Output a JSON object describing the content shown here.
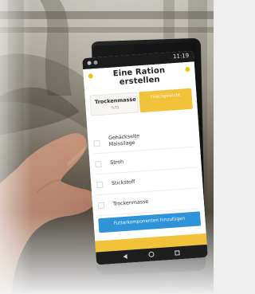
{
  "photo": {
    "alt": "Hand holding a smartphone showing a feed ration app inside a barn"
  },
  "status_bar": {
    "time": "11:19"
  },
  "app": {
    "title": "Eine Ration erstellen",
    "toggle_left_main": "Trockenmasse",
    "toggle_left_sub": "%TS",
    "toggle_right_label": "Frischgewicht",
    "table_header": [
      "",
      "",
      ""
    ],
    "rows": [
      {
        "name": "Gehäckselte Maissilage",
        "v1": "",
        "v2": ""
      },
      {
        "name": "Stroh",
        "v1": "",
        "v2": ""
      },
      {
        "name": "Stickstoff",
        "v1": "",
        "v2": ""
      },
      {
        "name": "Trockenmasse",
        "v1": "",
        "v2": ""
      }
    ],
    "cta": "Futterkomponenten hinzufügen",
    "bottom_label": ""
  },
  "colors": {
    "accent": "#f2c33a",
    "primary": "#2f93d8"
  }
}
